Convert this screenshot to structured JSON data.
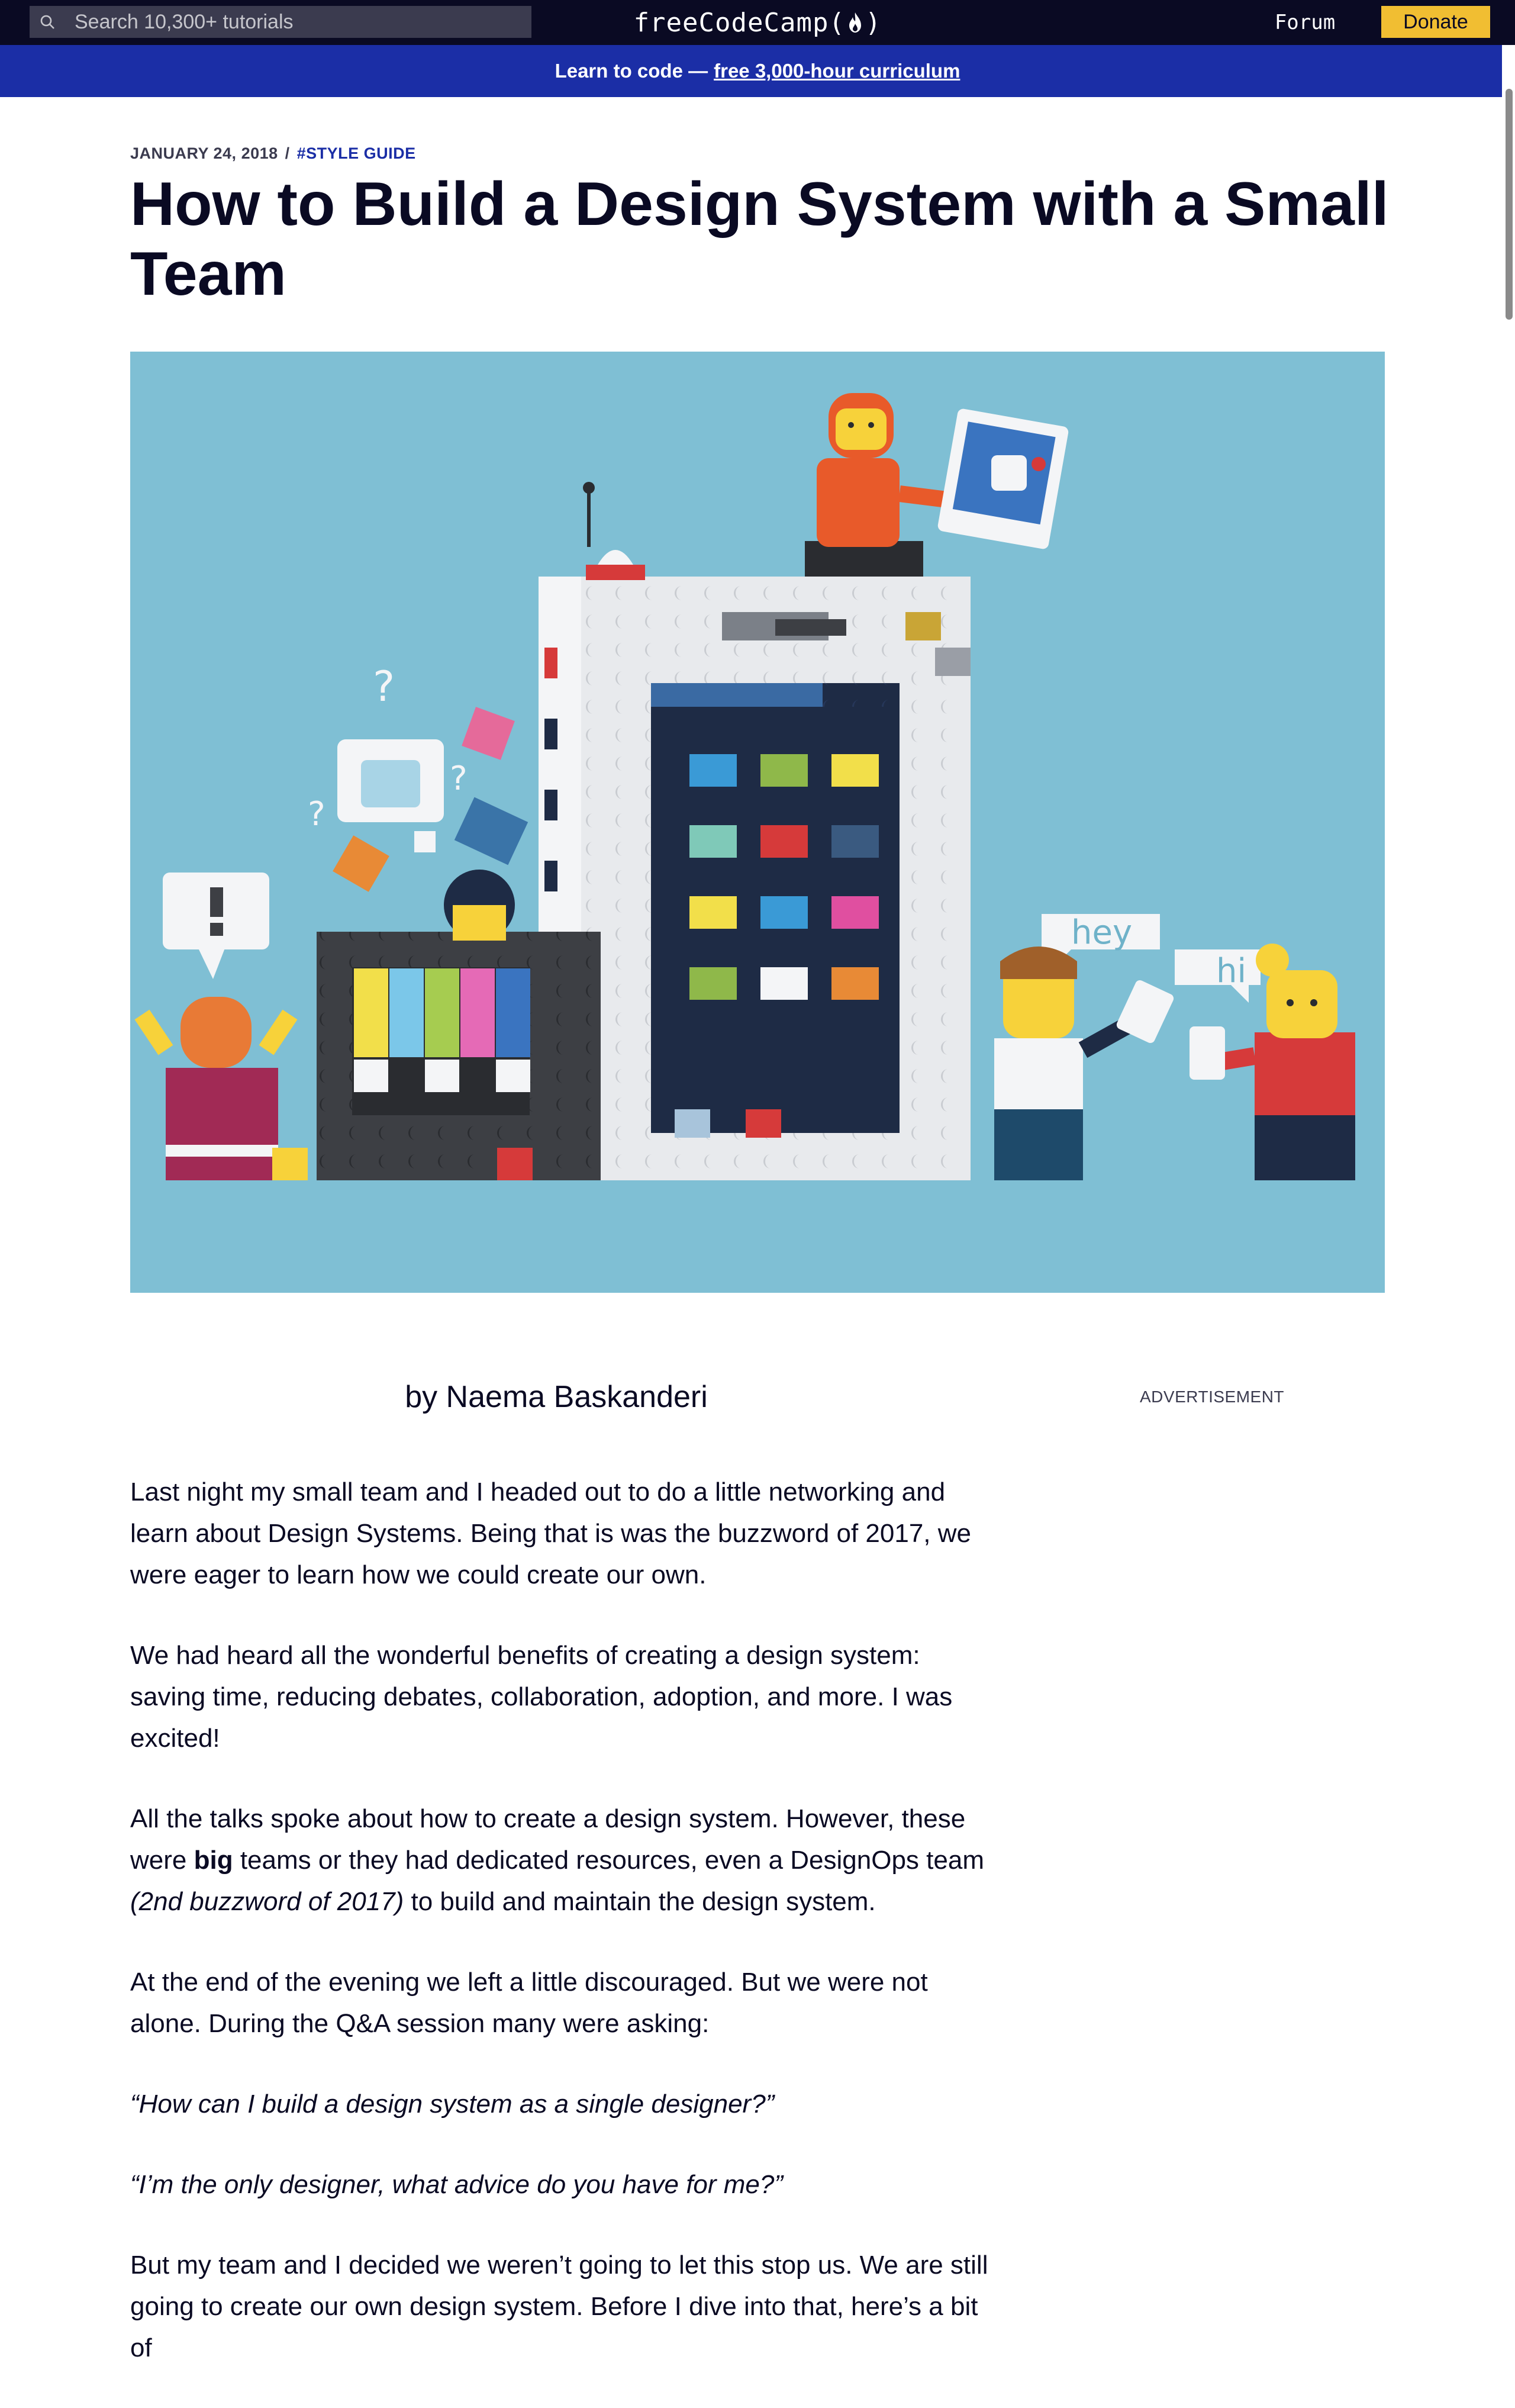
{
  "nav": {
    "search_placeholder": "Search 10,300+ tutorials",
    "logo_left": "freeCodeCamp(",
    "logo_right": ")",
    "forum_label": "Forum",
    "donate_label": "Donate"
  },
  "banner": {
    "prefix": "Learn to code —",
    "link": "free 3,000-hour curriculum"
  },
  "article": {
    "date": "JANUARY 24, 2018",
    "separator": "/",
    "tag": "#STYLE GUIDE",
    "title": "How to Build a Design System with a Small Team",
    "byline": "by Naema Baskanderi",
    "ad_label": "ADVERTISEMENT",
    "p1": "Last night my small team and I headed out to do a little networking and learn about Design Systems. Being that is was the buzzword of 2017, we were eager to learn how we could create our own.",
    "p2": "We had heard all the wonderful benefits of creating a design system: saving time, reducing debates, collaboration, adoption, and more. I was excited!",
    "p3_a": "All the talks spoke about how to create a design system. However, these were",
    "p3_bold": "big",
    "p3_b": "teams or they had dedicated resources, even a DesignOps team",
    "p3_italic": "(2nd buzzword of 2017)",
    "p3_c": "to build and maintain the design system.",
    "p4": "At the end of the evening we left a little discouraged. But we were not alone. During the Q&A session many were asking:",
    "q1": "“How can I build a design system as a single designer?”",
    "q2": "“I’m the only designer, what advice do you have for me?”",
    "p5": "But my team and I decided we weren’t going to let this stop us. We are still going to create our own design system. Before I dive into that, here’s a bit of"
  },
  "hero": {
    "bubble_hey": "hey",
    "bubble_hi": "hi",
    "colors": {
      "background": "#7fbfd4",
      "nav": "#0a0a23",
      "banner": "#1b2ea6",
      "donate": "#f1be32"
    }
  }
}
